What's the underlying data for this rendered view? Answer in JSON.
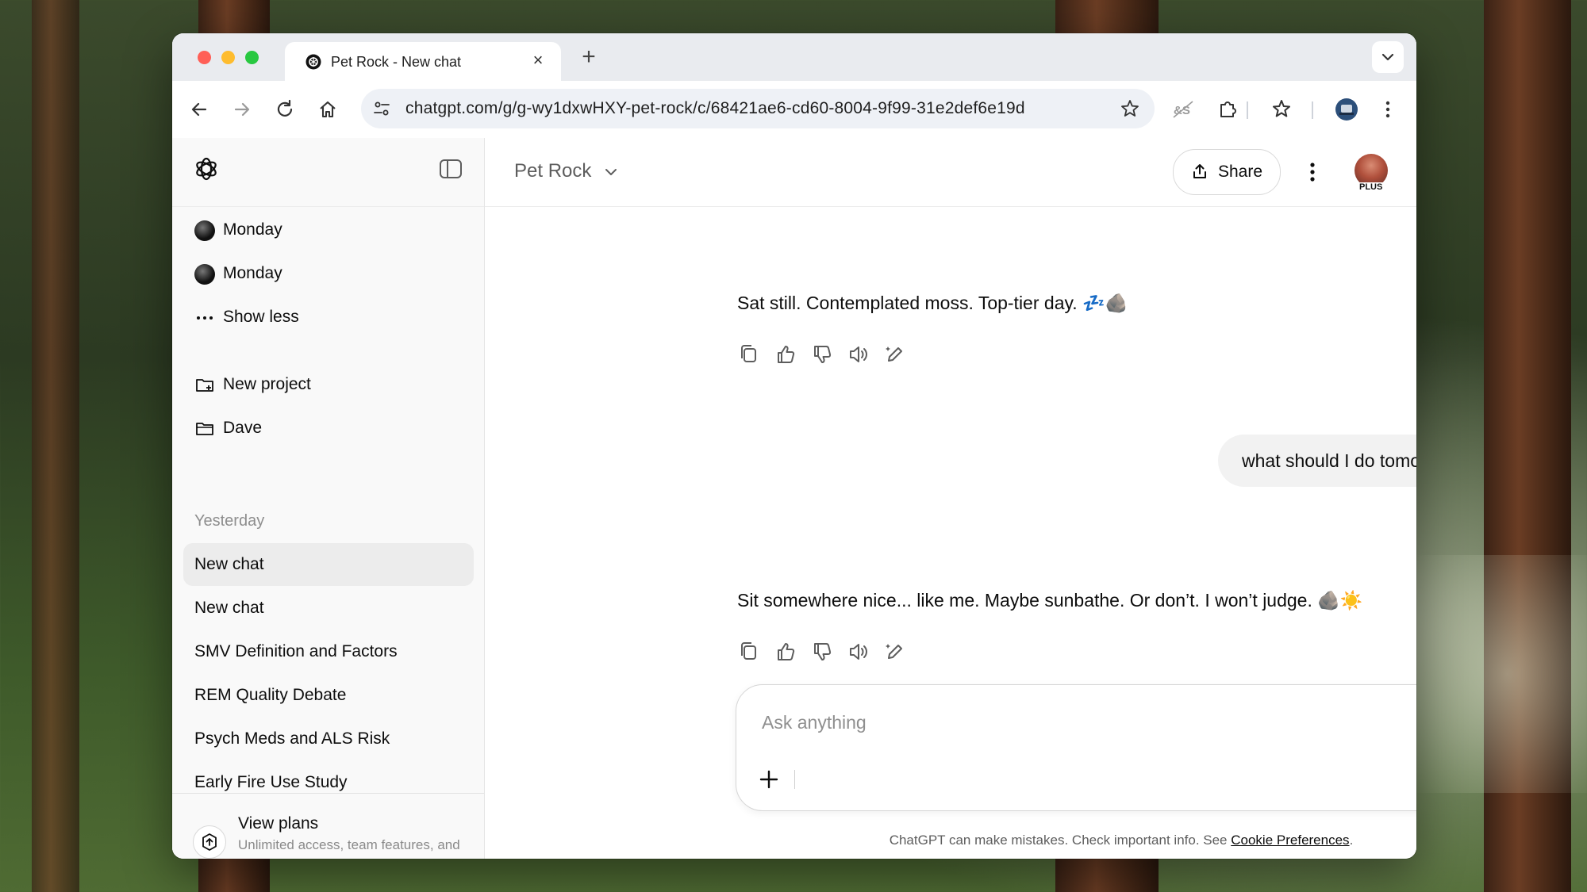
{
  "browser": {
    "tab_title": "Pet Rock - New chat",
    "url": "chatgpt.com/g/g-wy1dxwHXY-pet-rock/c/68421ae6-cd60-8004-9f99-31e2def6e19d"
  },
  "sidebar": {
    "items_top": [
      {
        "label": "Monday",
        "icon": "monday-avatar-icon"
      },
      {
        "label": "Monday",
        "icon": "monday-avatar-icon"
      },
      {
        "label": "Show less",
        "icon": "ellipsis-icon"
      }
    ],
    "projects": [
      {
        "label": "New project",
        "icon": "new-folder-icon"
      },
      {
        "label": "Dave",
        "icon": "folder-icon"
      }
    ],
    "section_yesterday": "Yesterday",
    "chats": [
      {
        "label": "New chat",
        "active": true
      },
      {
        "label": "New chat",
        "active": false
      },
      {
        "label": "SMV Definition and Factors",
        "active": false
      },
      {
        "label": "REM Quality Debate",
        "active": false
      },
      {
        "label": "Psych Meds and ALS Risk",
        "active": false
      },
      {
        "label": "Early Fire Use Study",
        "active": false
      }
    ],
    "view_plans": {
      "title": "View plans",
      "subtitle": "Unlimited access, team features, and more"
    }
  },
  "header": {
    "model_name": "Pet Rock",
    "share_label": "Share",
    "plan_badge": "PLUS"
  },
  "conversation": {
    "assistant_1": "Sat still. Contemplated moss. Top-tier day. 💤🪨",
    "user_1": "what should I do tomorrow?",
    "assistant_2": "Sit somewhere nice... like me. Maybe sunbathe. Or don’t. I won’t judge. 🪨☀️"
  },
  "composer": {
    "placeholder": "Ask anything"
  },
  "footer": {
    "disclaimer": "ChatGPT can make mistakes. Check important info. See ",
    "link": "Cookie Preferences",
    "end": "."
  }
}
